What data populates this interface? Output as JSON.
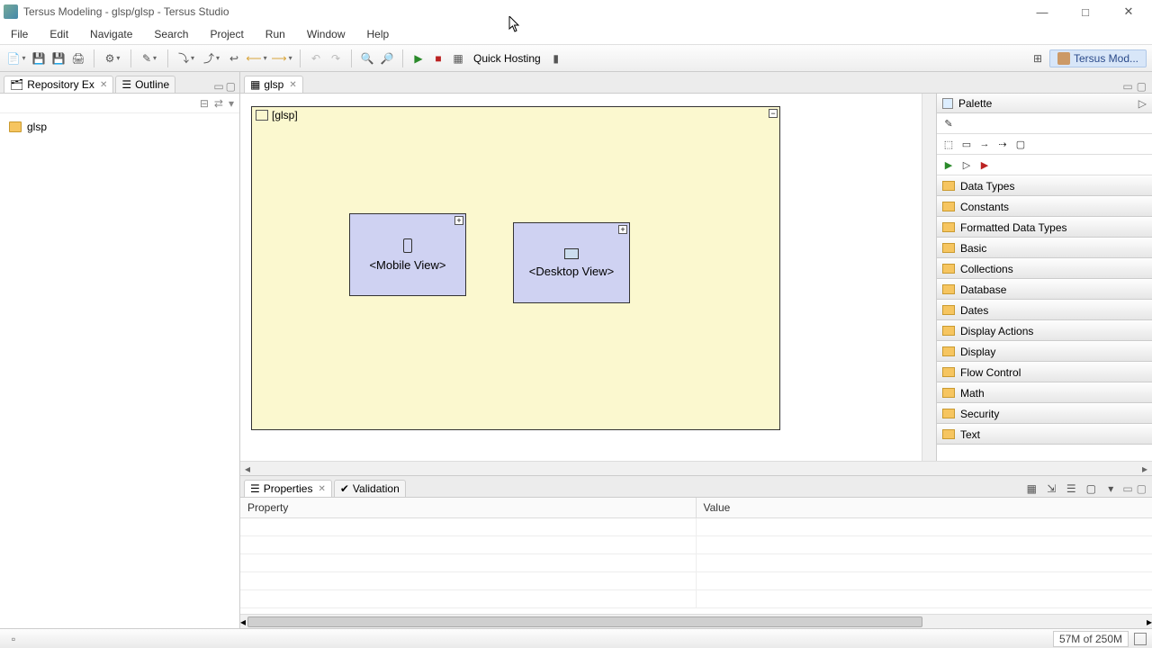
{
  "window": {
    "title": "Tersus Modeling - glsp/glsp - Tersus Studio"
  },
  "menu": {
    "items": [
      "File",
      "Edit",
      "Navigate",
      "Search",
      "Project",
      "Run",
      "Window",
      "Help"
    ]
  },
  "toolbar": {
    "quick_hosting": "Quick Hosting"
  },
  "perspective": {
    "label": "Tersus Mod..."
  },
  "left": {
    "tabs": {
      "repo": "Repository Ex",
      "outline": "Outline"
    },
    "tree": {
      "root": "glsp"
    }
  },
  "editor": {
    "tab": "glsp",
    "root_label": "[glsp]",
    "nodes": {
      "mobile": "<Mobile View>",
      "desktop": "<Desktop View>"
    }
  },
  "palette": {
    "title": "Palette",
    "cats": [
      "Data Types",
      "Constants",
      "Formatted Data Types",
      "Basic",
      "Collections",
      "Database",
      "Dates",
      "Display Actions",
      "Display",
      "Flow Control",
      "Math",
      "Security",
      "Text"
    ]
  },
  "bottom": {
    "tabs": {
      "properties": "Properties",
      "validation": "Validation"
    },
    "cols": {
      "property": "Property",
      "value": "Value"
    }
  },
  "status": {
    "memory": "57M of 250M"
  }
}
